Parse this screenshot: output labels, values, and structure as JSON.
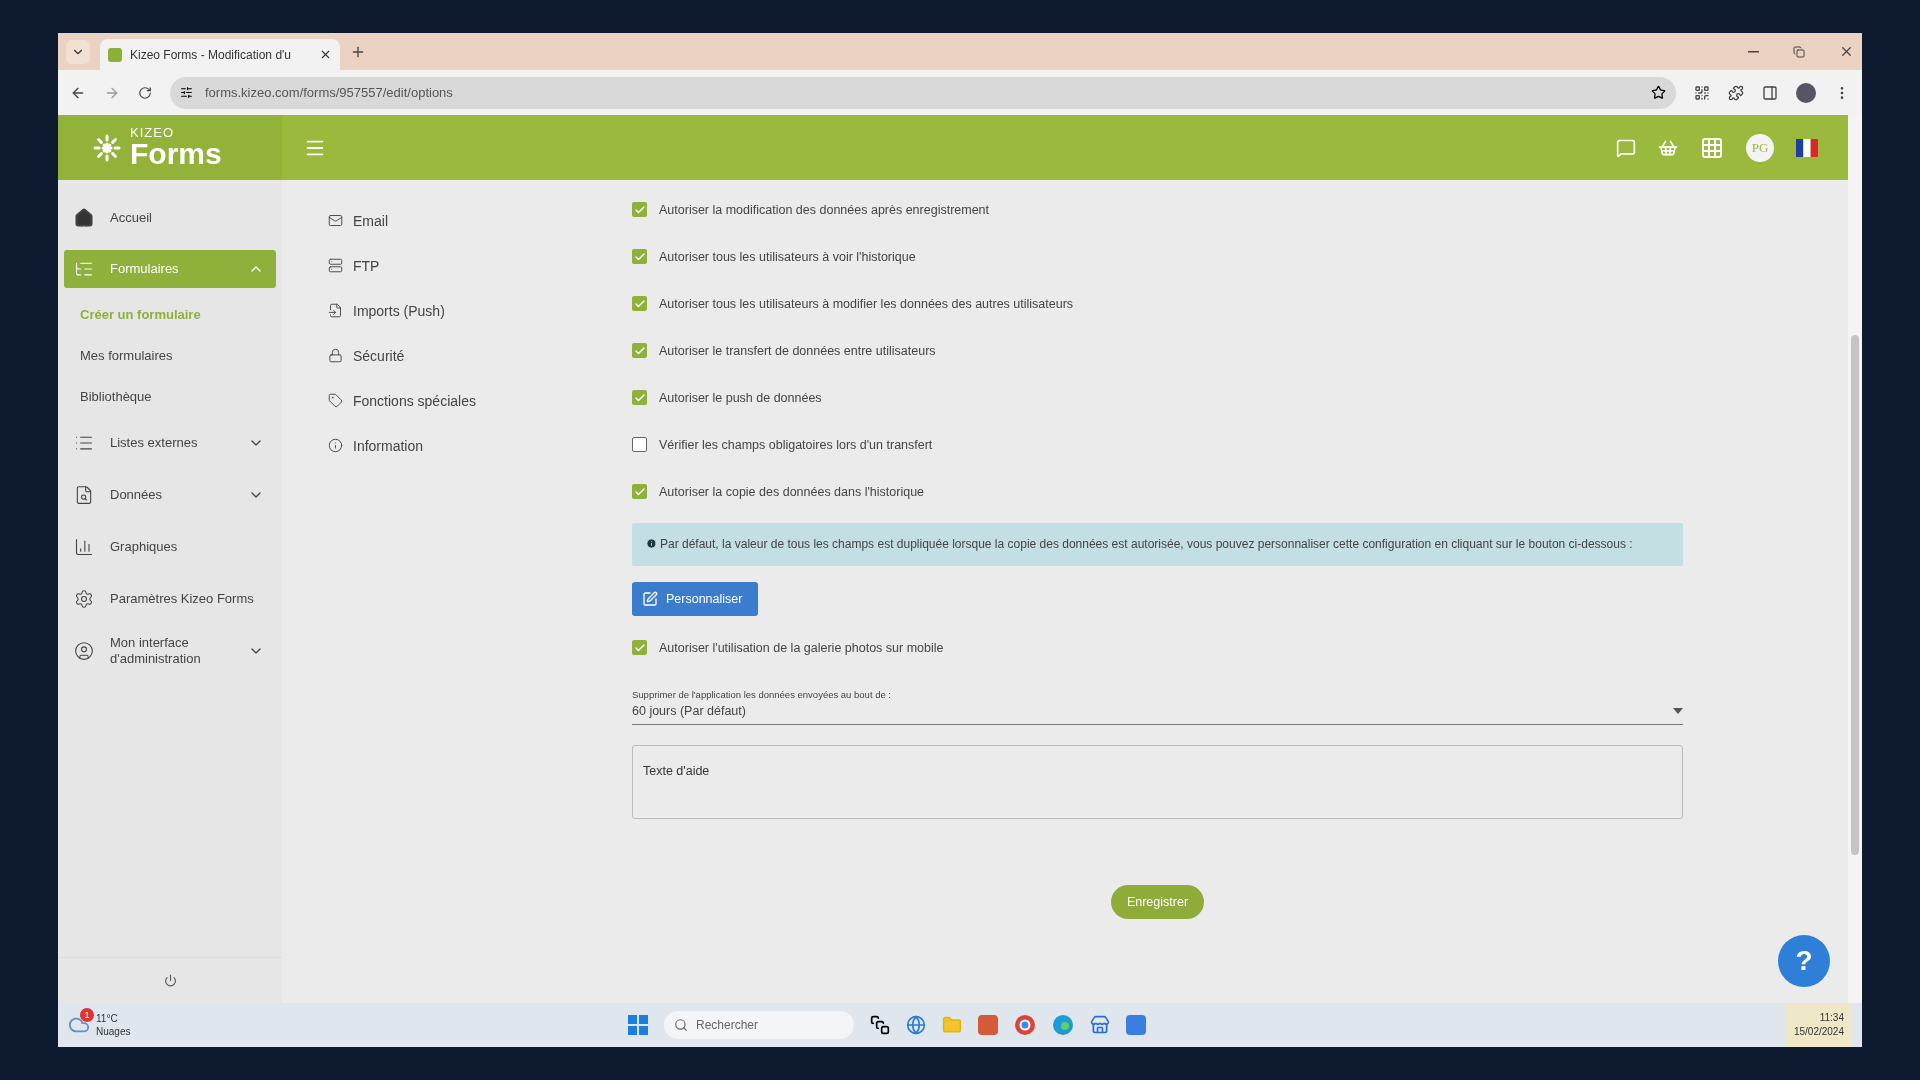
{
  "browser": {
    "tab_title": "Kizeo Forms - Modification d'u",
    "url": "forms.kizeo.com/forms/957557/edit/options"
  },
  "header": {
    "logo_small": "KIZEO",
    "logo_big": "Forms",
    "user_initials": "PG"
  },
  "sidebar": {
    "items": [
      {
        "label": "Accueil",
        "selected": false
      },
      {
        "label": "Formulaires",
        "selected": true,
        "expanded": true,
        "children": [
          {
            "label": "Créer un formulaire",
            "selected": true
          },
          {
            "label": "Mes formulaires",
            "selected": false
          },
          {
            "label": "Bibliothèque",
            "selected": false
          }
        ]
      },
      {
        "label": "Listes externes",
        "selected": false,
        "expanded": false
      },
      {
        "label": "Données",
        "selected": false,
        "expanded": false
      },
      {
        "label": "Graphiques",
        "selected": false
      },
      {
        "label": "Paramètres Kizeo Forms",
        "selected": false
      },
      {
        "label": "Mon interface d'administration",
        "selected": false,
        "expanded": false
      }
    ]
  },
  "options_menu": [
    {
      "label": "Email"
    },
    {
      "label": "FTP"
    },
    {
      "label": "Imports (Push)"
    },
    {
      "label": "Sécurité"
    },
    {
      "label": "Fonctions spéciales"
    },
    {
      "label": "Information"
    }
  ],
  "options": [
    {
      "label": "Autoriser la modification des données après enregistrement",
      "checked": true
    },
    {
      "label": "Autoriser tous les utilisateurs à voir l'historique",
      "checked": true
    },
    {
      "label": "Autoriser tous les utilisateurs à modifier les données des autres utilisateurs",
      "checked": true
    },
    {
      "label": "Autoriser le transfert de données entre utilisateurs",
      "checked": true
    },
    {
      "label": "Autoriser le push de données",
      "checked": true
    },
    {
      "label": "Vérifier les champs obligatoires lors d'un transfert",
      "checked": false
    },
    {
      "label": "Autoriser la copie des données dans l'historique",
      "checked": true
    }
  ],
  "info_note": "Par défaut, la valeur de tous les champs est dupliquée lorsque la copie des données est autorisée, vous pouvez personnaliser cette configuration en cliquant sur le bouton ci-dessous :",
  "customize_button": "Personnaliser",
  "gallery_option": {
    "label": "Autoriser l'utilisation de la galerie photos sur mobile",
    "checked": true
  },
  "retention_select": {
    "label": "Supprimer de l'application les données envoyées au bout de :",
    "value": "60 jours (Par défaut)"
  },
  "help_text": {
    "placeholder": "Texte d'aide"
  },
  "save_button": "Enregistrer",
  "help_button": "?",
  "taskbar": {
    "weather_badge": "1",
    "temperature": "11°C",
    "condition": "Nuages",
    "search_placeholder": "Rechercher",
    "time": "11:34",
    "date": "15/02/2024"
  }
}
